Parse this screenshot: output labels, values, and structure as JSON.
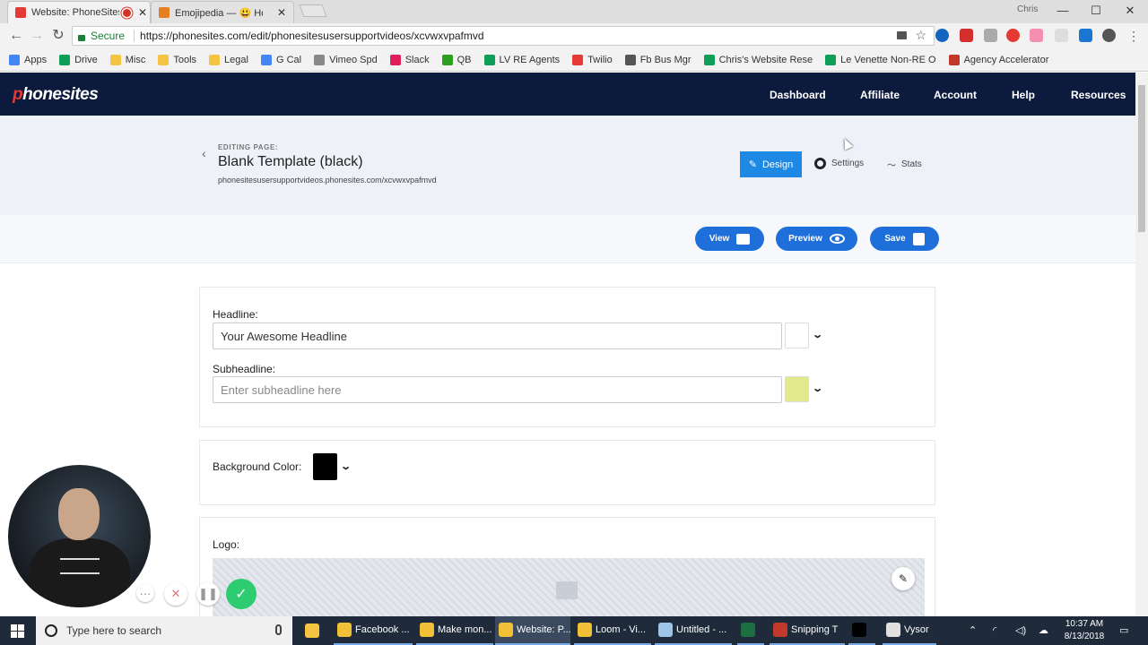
{
  "browser": {
    "tabs": [
      {
        "title": "Website: PhoneSites U",
        "active": true,
        "favicon_color": "#e53935",
        "recording": true
      },
      {
        "title": "Emojipedia — 😃 Ho",
        "active": false,
        "favicon_color": "#e67e22"
      }
    ],
    "user": "Chris",
    "window_controls": {
      "minimize": "—",
      "maximize": "☐",
      "close": "✕"
    },
    "address": {
      "secure_label": "Secure",
      "url": "https://phonesites.com/edit/phonesitesusersupportvideos/xcvwxvpafmvd"
    },
    "bookmarks": [
      {
        "label": "Apps",
        "icon": "apps-grid-icon",
        "color": "#4285f4"
      },
      {
        "label": "Drive",
        "icon": "drive-icon",
        "color": "#0f9d58"
      },
      {
        "label": "Misc",
        "icon": "folder-icon",
        "color": "#f4c542"
      },
      {
        "label": "Tools",
        "icon": "folder-icon",
        "color": "#f4c542"
      },
      {
        "label": "Legal",
        "icon": "folder-icon",
        "color": "#f4c542"
      },
      {
        "label": "G Cal",
        "icon": "calendar-icon",
        "color": "#4285f4"
      },
      {
        "label": "Vimeo Spd",
        "icon": "document-icon",
        "color": "#888888"
      },
      {
        "label": "Slack",
        "icon": "slack-icon",
        "color": "#e01e5a"
      },
      {
        "label": "QB",
        "icon": "quickbooks-icon",
        "color": "#2ca01c"
      },
      {
        "label": "LV RE Agents",
        "icon": "sheets-icon",
        "color": "#0f9d58"
      },
      {
        "label": "Twilio",
        "icon": "twilio-icon",
        "color": "#e53935"
      },
      {
        "label": "Fb Bus Mgr",
        "icon": "bookmark-icon",
        "color": "#555555"
      },
      {
        "label": "Chris's Website Rese",
        "icon": "sheets-icon",
        "color": "#0f9d58"
      },
      {
        "label": "Le Venette Non-RE O",
        "icon": "sheets-icon",
        "color": "#0f9d58"
      },
      {
        "label": "Agency Accelerator",
        "icon": "bookmark-icon",
        "color": "#c0392b"
      }
    ]
  },
  "site": {
    "logo_prefix": "p",
    "logo_rest": "honesites",
    "nav": [
      "Dashboard",
      "Affiliate",
      "Account",
      "Help",
      "Resources"
    ]
  },
  "editor": {
    "editing_label": "EDITING PAGE:",
    "page_title": "Blank Template (black)",
    "page_url": "phonesitesusersupportvideos.phonesites.com/xcvwxvpafmvd",
    "tabs": {
      "design": "Design",
      "settings": "Settings",
      "stats": "Stats"
    },
    "actions": {
      "view": "View",
      "preview": "Preview",
      "save": "Save"
    },
    "headline": {
      "label": "Headline:",
      "value": "Your Awesome Headline",
      "color": "#ffffff"
    },
    "subheadline": {
      "label": "Subheadline:",
      "placeholder": "Enter subheadline here",
      "color": "#e2e88c"
    },
    "background": {
      "label": "Background Color:",
      "color": "#000000"
    },
    "logo": {
      "label": "Logo:"
    }
  },
  "colors": {
    "nav_bg": "#0c1b3d",
    "accent": "#1e6fd9",
    "design_active": "#1e88e5"
  },
  "taskbar": {
    "search_placeholder": "Type here to search",
    "items": [
      {
        "label": "Facebook ...",
        "icon": "chrome-icon"
      },
      {
        "label": "Make mon...",
        "icon": "chrome-icon"
      },
      {
        "label": "Website: P...",
        "icon": "chrome-icon"
      },
      {
        "label": "Loom - Vi...",
        "icon": "chrome-icon"
      },
      {
        "label": "Untitled - ...",
        "icon": "notepad-icon"
      },
      {
        "label": "",
        "icon": "excel-icon"
      },
      {
        "label": "Snipping T",
        "icon": "snipping-tool-icon"
      },
      {
        "label": "",
        "icon": "cmd-icon"
      },
      {
        "label": "Vysor",
        "icon": "vysor-icon"
      }
    ],
    "time": "10:37 AM",
    "date": "8/13/2018"
  }
}
